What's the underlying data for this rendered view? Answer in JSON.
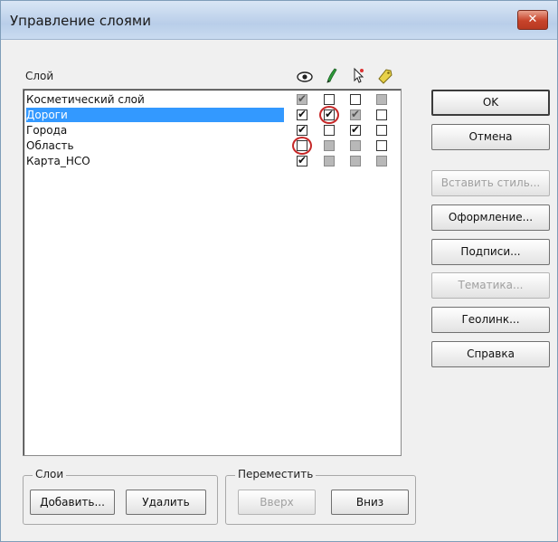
{
  "window": {
    "title": "Управление слоями",
    "close_label": "✕"
  },
  "layers_panel": {
    "column_header": "Слой",
    "column_icons": [
      "eye-icon",
      "pencil-icon",
      "cursor-star-icon",
      "tag-icon"
    ],
    "rows": [
      {
        "name": "Косметический слой",
        "selected": false,
        "checks": [
          [
            "checked-gray"
          ],
          [
            "unchecked"
          ],
          [
            "unchecked"
          ],
          [
            "gray"
          ]
        ]
      },
      {
        "name": "Дороги",
        "selected": true,
        "checks": [
          [
            "checked"
          ],
          [
            "checked"
          ],
          [
            "checked-gray"
          ],
          [
            "unchecked"
          ]
        ]
      },
      {
        "name": "Города",
        "selected": false,
        "checks": [
          [
            "checked"
          ],
          [
            "unchecked"
          ],
          [
            "checked"
          ],
          [
            "unchecked"
          ]
        ]
      },
      {
        "name": "Область",
        "selected": false,
        "checks": [
          [
            "unchecked"
          ],
          [
            "gray"
          ],
          [
            "gray"
          ],
          [
            "unchecked"
          ]
        ]
      },
      {
        "name": "Карта_НСО",
        "selected": false,
        "checks": [
          [
            "checked"
          ],
          [
            "gray"
          ],
          [
            "gray"
          ],
          [
            "gray"
          ]
        ]
      }
    ]
  },
  "buttons": {
    "ok": "OK",
    "cancel": "Отмена",
    "paste_style": "Вставить стиль...",
    "format": "Оформление...",
    "labels": "Подписи...",
    "thematic": "Тематика...",
    "geolink": "Геолинк...",
    "help": "Справка"
  },
  "groups": {
    "layers": {
      "label": "Слои",
      "add": "Добавить...",
      "delete": "Удалить"
    },
    "move": {
      "label": "Переместить",
      "up": "Вверх",
      "down": "Вниз"
    }
  }
}
